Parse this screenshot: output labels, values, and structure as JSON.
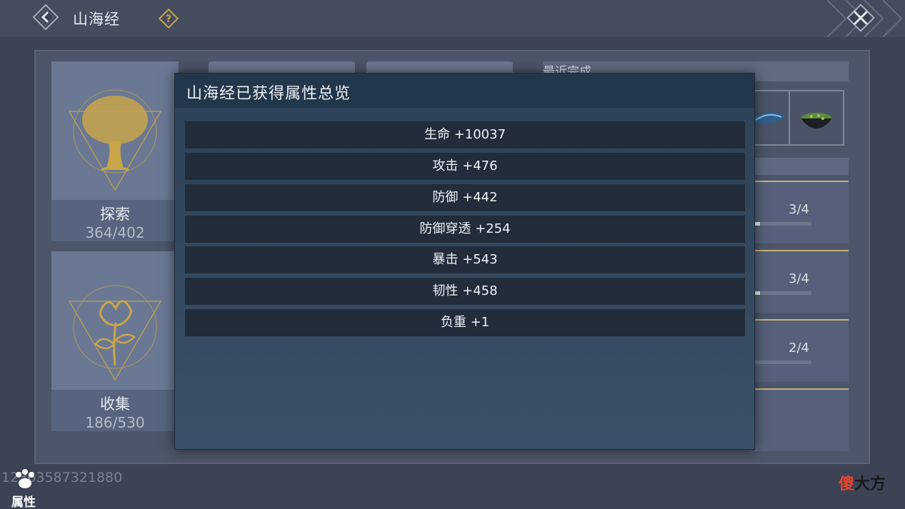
{
  "header": {
    "title": "山海经",
    "back_icon": "chevron-left-icon",
    "help_icon": "question-icon",
    "close_icon": "close-icon"
  },
  "cards": [
    {
      "label": "探索",
      "count": "364/402",
      "icon": "tree-emblem-icon"
    },
    {
      "label": "收集",
      "count": "186/530",
      "icon": "flower-emblem-icon"
    }
  ],
  "recent": {
    "header": "最近完成"
  },
  "tasks": [
    {
      "progress": "3/4",
      "fraction": 0.1
    },
    {
      "progress": "3/4",
      "fraction": 0.1
    },
    {
      "progress": "2/4",
      "fraction": 0.0
    }
  ],
  "modal": {
    "title": "山海经已获得属性总览",
    "stats": [
      "生命 +10037",
      "攻击 +476",
      "防御 +442",
      "防御穿透 +254",
      "暴击 +543",
      "韧性 +458",
      "负重 +1"
    ]
  },
  "footer": {
    "uid": "12363587321880",
    "attr_label": "属性",
    "attr_icon": "paw-icon"
  },
  "watermark": {
    "part1": "傻",
    "part2": "大方"
  },
  "colors": {
    "accent_gold": "#c8a54a",
    "modal_bg": "#33485f",
    "row_bg": "#222c3a"
  }
}
